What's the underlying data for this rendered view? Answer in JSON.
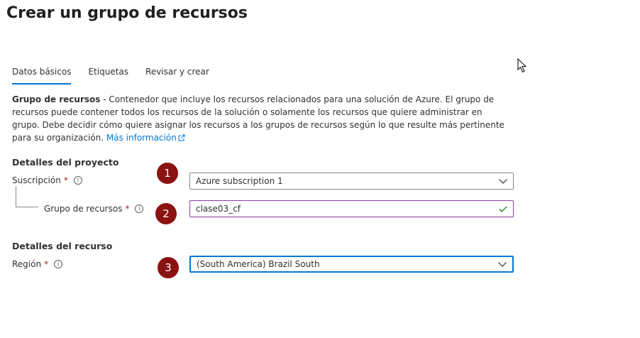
{
  "header": {
    "title": "Crear un grupo de recursos",
    "more_label": "···"
  },
  "tabs": [
    {
      "label": "Datos básicos",
      "active": true
    },
    {
      "label": "Etiquetas",
      "active": false
    },
    {
      "label": "Revisar y crear",
      "active": false
    }
  ],
  "description": {
    "bold_term": "Grupo de recursos",
    "text": " - Contenedor que incluye los recursos relacionados para una solución de Azure. El grupo de recursos puede contener todos los recursos de la solución o solamente los recursos que quiere administrar en grupo. Debe decidir cómo quiere asignar los recursos a los grupos de recursos según lo que resulte más pertinente para su organización. ",
    "link_label": "Más información"
  },
  "project_details": {
    "heading": "Detalles del proyecto",
    "subscription": {
      "label": "Suscripción",
      "required_mark": "*",
      "value": "Azure subscription 1"
    },
    "resource_group": {
      "label": "Grupo de recursos",
      "required_mark": "*",
      "value": "clase03_cf"
    }
  },
  "resource_details": {
    "heading": "Detalles del recurso",
    "region": {
      "label": "Región",
      "required_mark": "*",
      "value": "(South America) Brazil South"
    }
  },
  "badges": [
    "1",
    "2",
    "3"
  ],
  "colors": {
    "accent": "#0078d4",
    "badge": "#8b1212",
    "required": "#a4262c",
    "valid_check": "#107c10"
  },
  "icons": {
    "info": "info-icon",
    "external_link": "external-link-icon",
    "chevron": "chevron-down-icon",
    "check": "checkmark-icon",
    "cursor": "mouse-cursor-icon"
  }
}
